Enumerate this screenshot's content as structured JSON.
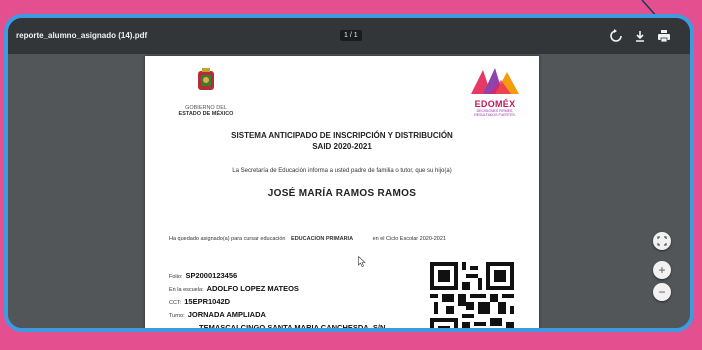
{
  "toolbar": {
    "filename": "reporte_alumno_asignado (14).pdf",
    "page_indicator": "1 / 1",
    "icons": [
      "rotate-icon",
      "download-icon",
      "print-icon"
    ]
  },
  "document": {
    "gov_logo_line1": "GOBIERNO DEL",
    "gov_logo_line2": "ESTADO DE MÉXICO",
    "edomex_name": "EDOMÉX",
    "edomex_slogan_1": "DECISIONES FIRMES,",
    "edomex_slogan_2": "RESULTADOS FUERTES.",
    "heading_line1": "SISTEMA ANTICIPADO DE INSCRIPCIÓN Y DISTRIBUCIÓN",
    "heading_line2": "SAID 2020-2021",
    "intro": "La Secretaría de Educación informa a usted padre de familia o tutor, que su hijo(a)",
    "student_name": "JOSÉ MARÍA RAMOS RAMOS",
    "assigned_text": "Ha quedado asignado(a) para cursar educación",
    "education_level": "EDUCACION PRIMARIA",
    "cycle_text": "en el Ciclo Escolar 2020-2021",
    "folio_label": "Folio:",
    "folio_value": "SP2000123456",
    "school_label": "En la escuela:",
    "school_value": "ADOLFO LOPEZ MATEOS",
    "cct_label": "CCT:",
    "cct_value": "15EPR1042D",
    "shift_label": "Turno:",
    "shift_value": "JORNADA AMPLIADA",
    "address_value": "TEMASCALCINGO SANTA MARIA CANCHESDA, S/N"
  },
  "zoom": {
    "fit": "fit-page-icon",
    "in": "+",
    "out": "−"
  },
  "colors": {
    "background": "#e4508f",
    "frame_border": "#3d9be0",
    "toolbar": "#323639",
    "viewer": "#525659"
  }
}
